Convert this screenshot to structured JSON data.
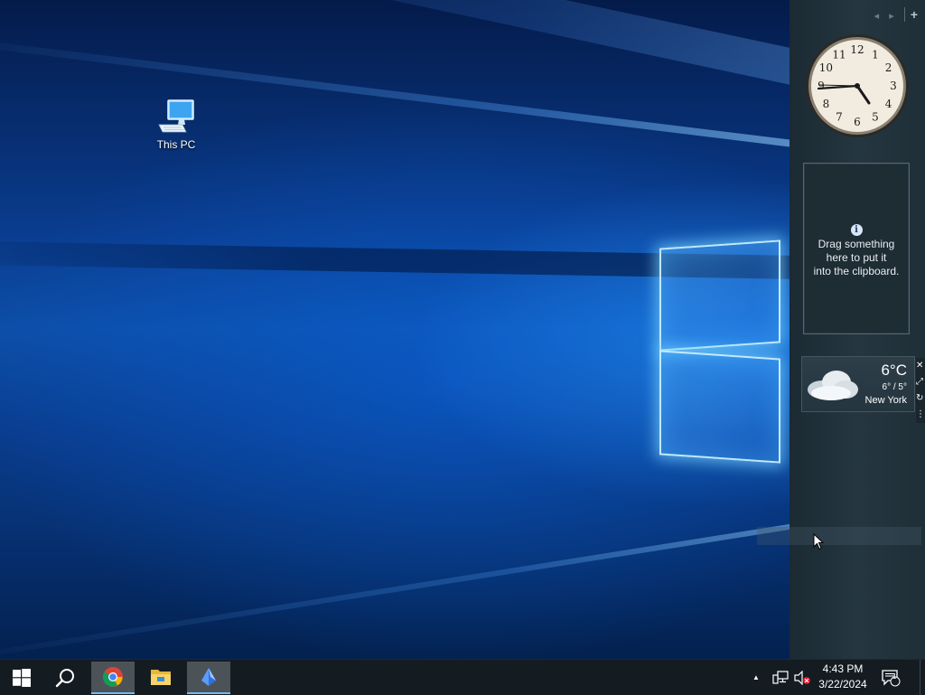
{
  "desktop": {
    "icons": [
      {
        "label": "This PC",
        "icon": "computer-icon"
      }
    ]
  },
  "sidebar": {
    "nav": {
      "prev": "◂",
      "next": "▸",
      "add": "+"
    },
    "clock_gadget": {
      "numbers": [
        "12",
        "1",
        "2",
        "3",
        "4",
        "5",
        "6",
        "7",
        "8",
        "9",
        "10",
        "11"
      ],
      "time_shown": "4:43"
    },
    "clipboard_gadget": {
      "info_icon": "i",
      "line1": "Drag something",
      "line2": "here to put it",
      "line3": "into the clipboard."
    },
    "weather_gadget": {
      "temperature": "6°C",
      "range": "6° / 5°",
      "city": "New York",
      "condition_icon": "cloud-icon"
    },
    "weather_tools": {
      "close": "✕",
      "resize": "⤢",
      "options": "↻",
      "drag": "⋮"
    }
  },
  "taskbar": {
    "start_icon": "windows-icon",
    "search_icon": "search-icon",
    "apps": [
      {
        "name": "Chrome",
        "icon": "chrome-icon",
        "active": true
      },
      {
        "name": "File Explorer",
        "icon": "folder-icon",
        "active": false
      },
      {
        "name": "App",
        "icon": "crystal-icon",
        "active": true
      }
    ],
    "tray": {
      "overflow": "▲",
      "network_icon": "network-icon",
      "volume_icon": "volume-muted-icon",
      "time": "4:43 PM",
      "date": "3/22/2024",
      "notifications_count": "1"
    }
  },
  "colors": {
    "accent": "#76b9ed",
    "taskbar": "#141c22",
    "sidebar": "#253640",
    "wallpaper_blue": "#0c4ea8"
  }
}
